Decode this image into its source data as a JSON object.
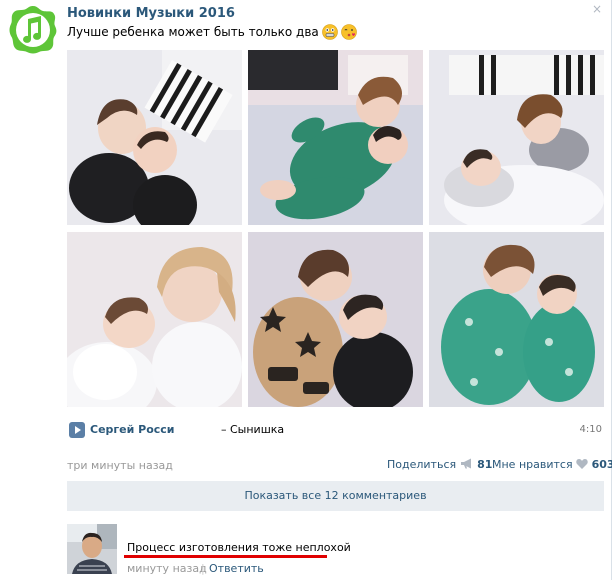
{
  "post": {
    "author": "Новинки Музыки 2016",
    "text": "Лучше ребенка может быть только два",
    "close_glyph": "×"
  },
  "photos": [
    "photo-1",
    "photo-2",
    "photo-3",
    "photo-4",
    "photo-5",
    "photo-6"
  ],
  "audio": {
    "artist": "Сергей Росси",
    "title": "– Сынишка",
    "duration": "4:10"
  },
  "meta": {
    "time": "три минуты назад",
    "share_label": "Поделиться",
    "share_count": "81",
    "like_label": "Мне нравится",
    "like_count": "603"
  },
  "comments": {
    "show_all_label": "Показать все 12 комментариев",
    "items": [
      {
        "text": "Процесс изготовления тоже неплохой",
        "time": "минуту назад",
        "separator": "|",
        "reply_label": "Ответить"
      }
    ]
  },
  "colors": {
    "link": "#2b587a",
    "muted": "#999999",
    "panel": "#e9edf1",
    "highlight": "#e00000",
    "group_avatar": "#5ec538"
  },
  "icons": [
    "music-note-icon",
    "grimace-emoji-icon",
    "kiss-emoji-icon",
    "play-icon",
    "share-megaphone-icon",
    "heart-icon",
    "close-icon"
  ]
}
